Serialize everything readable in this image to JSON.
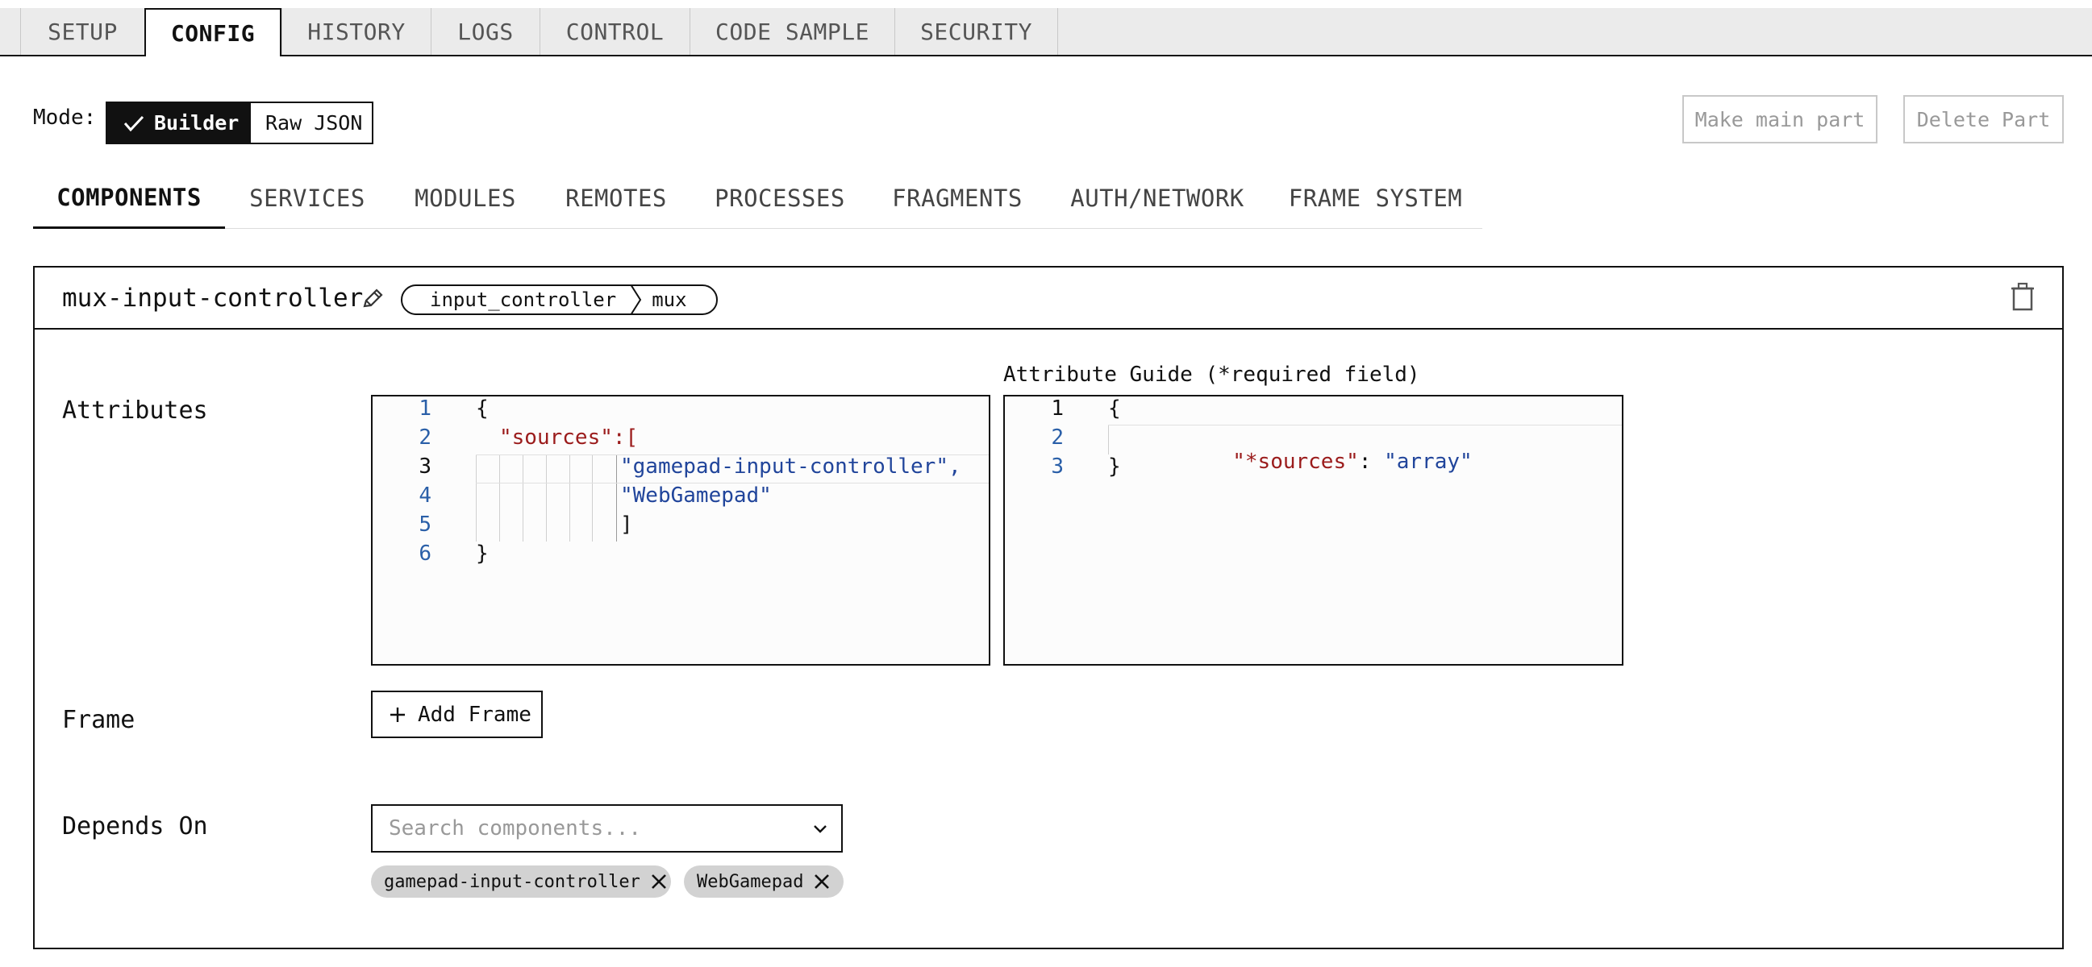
{
  "top_tabs": {
    "items": [
      "SETUP",
      "CONFIG",
      "HISTORY",
      "LOGS",
      "CONTROL",
      "CODE SAMPLE",
      "SECURITY"
    ],
    "active": "CONFIG"
  },
  "mode": {
    "label": "Mode:",
    "options": [
      "Builder",
      "Raw JSON"
    ],
    "selected": "Builder"
  },
  "part_actions": {
    "make_main": "Make main part",
    "delete": "Delete Part"
  },
  "sub_tabs": {
    "items": [
      "COMPONENTS",
      "SERVICES",
      "MODULES",
      "REMOTES",
      "PROCESSES",
      "FRAGMENTS",
      "AUTH/NETWORK",
      "FRAME SYSTEM"
    ],
    "active": "COMPONENTS"
  },
  "component": {
    "name": "mux-input-controller",
    "api_type": "input_controller",
    "model": "mux",
    "attributes_label": "Attributes",
    "attributes_editor": {
      "line_numbers": [
        "1",
        "2",
        "3",
        "4",
        "5",
        "6"
      ],
      "current_line": "3",
      "lines": [
        "{",
        "\"sources\":[",
        "\"gamepad-input-controller\",",
        "\"WebGamepad\"",
        "]",
        "}"
      ]
    },
    "guide": {
      "title": "Attribute Guide (*required field)",
      "line_numbers": [
        "1",
        "2",
        "3"
      ],
      "current_line": "1",
      "key": "\"*sources\"",
      "value": "\"array\"",
      "open": "{",
      "close": "}"
    },
    "frame_label": "Frame",
    "add_frame": "Add Frame",
    "depends_on_label": "Depends On",
    "search_placeholder": "Search components...",
    "depends_on": [
      "gamepad-input-controller",
      "WebGamepad"
    ]
  },
  "icons": {
    "mode_selected": "check-icon",
    "rename": "pencil-icon",
    "delete_component": "trash-icon",
    "add_frame": "plus-icon",
    "dropdown": "chevron-down-icon",
    "chip_remove": "close-icon"
  },
  "colors": {
    "json_key": "#9b1c1c",
    "json_string": "#21459b",
    "line_number": "#2a5fa8",
    "chip_bg": "#d2d2d2",
    "disabled_text": "#999999"
  }
}
